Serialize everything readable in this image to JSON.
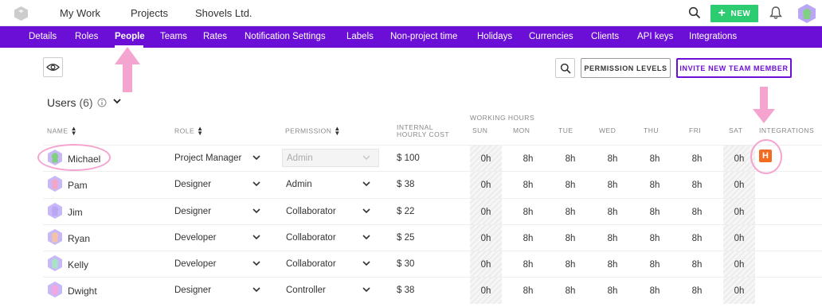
{
  "topbar": {
    "nav": [
      "My Work",
      "Projects",
      "Shovels Ltd."
    ],
    "new_label": "NEW"
  },
  "subnav": {
    "items": [
      "Details",
      "Roles",
      "People",
      "Teams",
      "Rates",
      "Notification Settings",
      "Labels",
      "Non-project time",
      "Holidays",
      "Currencies",
      "Clients",
      "API keys",
      "Integrations"
    ],
    "active": "People"
  },
  "toolbar": {
    "permission_levels": "PERMISSION LEVELS",
    "invite": "INVITE NEW TEAM MEMBER"
  },
  "users": {
    "title": "Users",
    "count": "(6)"
  },
  "columns": {
    "name": "NAME",
    "role": "ROLE",
    "permission": "PERMISSION",
    "cost_line1": "INTERNAL",
    "cost_line2": "HOURLY COST",
    "working_hours": "WORKING HOURS",
    "days": [
      "SUN",
      "MON",
      "TUE",
      "WED",
      "THU",
      "FRI",
      "SAT"
    ],
    "integrations": "INTEGRATIONS"
  },
  "rows": [
    {
      "name": "Michael",
      "role": "Project Manager",
      "permission": "Admin",
      "cost": "$ 100",
      "hours": [
        "0h",
        "8h",
        "8h",
        "8h",
        "8h",
        "8h",
        "0h"
      ],
      "integration": "H",
      "avatar_color": "#7fd07f"
    },
    {
      "name": "Pam",
      "role": "Designer",
      "permission": "Admin",
      "cost": "$ 38",
      "hours": [
        "0h",
        "8h",
        "8h",
        "8h",
        "8h",
        "8h",
        "0h"
      ],
      "avatar_color": "#f4a6c8"
    },
    {
      "name": "Jim",
      "role": "Designer",
      "permission": "Collaborator",
      "cost": "$ 22",
      "hours": [
        "0h",
        "8h",
        "8h",
        "8h",
        "8h",
        "8h",
        "0h"
      ],
      "avatar_color": "#b9a6f4"
    },
    {
      "name": "Ryan",
      "role": "Developer",
      "permission": "Collaborator",
      "cost": "$ 25",
      "hours": [
        "0h",
        "8h",
        "8h",
        "8h",
        "8h",
        "8h",
        "0h"
      ],
      "avatar_color": "#f4c2a6"
    },
    {
      "name": "Kelly",
      "role": "Developer",
      "permission": "Collaborator",
      "cost": "$ 30",
      "hours": [
        "0h",
        "8h",
        "8h",
        "8h",
        "8h",
        "8h",
        "0h"
      ],
      "avatar_color": "#a6e3c8"
    },
    {
      "name": "Dwight",
      "role": "Designer",
      "permission": "Controller",
      "cost": "$ 38",
      "hours": [
        "0h",
        "8h",
        "8h",
        "8h",
        "8h",
        "8h",
        "0h"
      ],
      "avatar_color": "#f4a6e0"
    }
  ],
  "colors": {
    "brand": "#6c0fd6",
    "new_button": "#2ecc71",
    "integration_badge": "#f26b21",
    "annotation": "#f5a3cf"
  }
}
